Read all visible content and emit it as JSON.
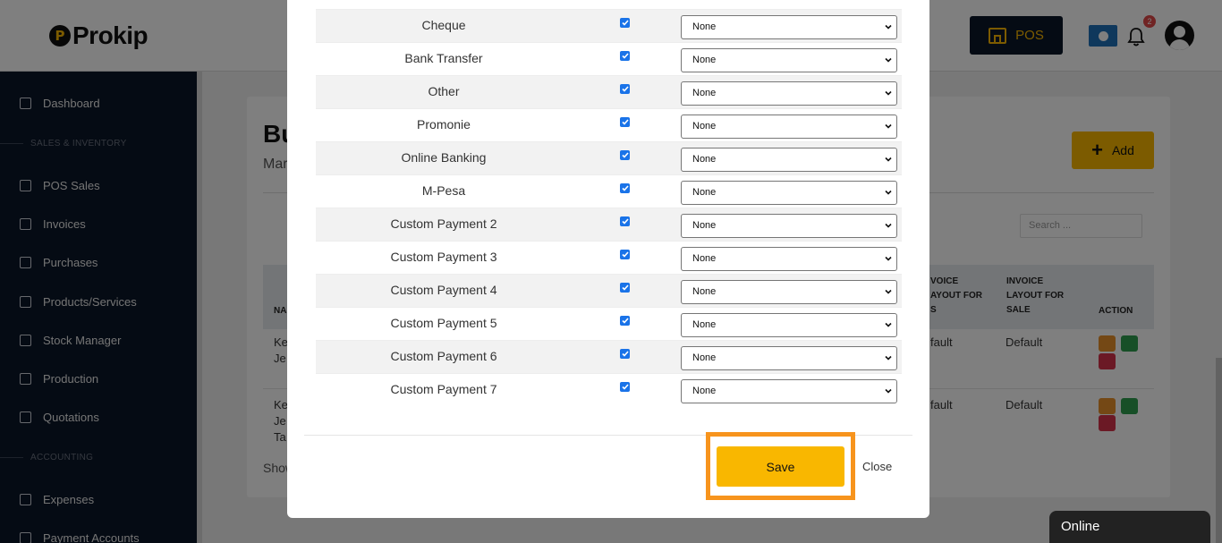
{
  "app": {
    "logo_text": "Prokip",
    "logo_mark": "P",
    "pos_label": "POS",
    "notification_count": "2"
  },
  "sidebar": {
    "items": [
      {
        "label": "Dashboard",
        "icon": "home-icon"
      },
      {
        "label": "POS Sales",
        "icon": "bag-icon"
      },
      {
        "label": "Invoices",
        "icon": "invoice-icon"
      },
      {
        "label": "Purchases",
        "icon": "cart-icon"
      },
      {
        "label": "Products/Services",
        "icon": "box-icon"
      },
      {
        "label": "Stock Manager",
        "icon": "stock-icon"
      },
      {
        "label": "Production",
        "icon": "building-icon"
      },
      {
        "label": "Quotations",
        "icon": "quote-icon"
      },
      {
        "label": "Expenses",
        "icon": "clock-icon"
      },
      {
        "label": "Payment Accounts",
        "icon": "wallet-icon"
      }
    ],
    "headings": [
      "SALES & INVENTORY",
      "ACCOUNTING"
    ]
  },
  "background_page": {
    "title_partial": "Bu",
    "subtitle_partial": "Mar",
    "add_label": "Add",
    "search_placeholder": "Search ...",
    "table": {
      "headers": [
        "NA",
        "VOICE LAYOUT FOR S",
        "INVOICE LAYOUT FOR SALE",
        "ACTION"
      ],
      "header_col_a_partial": "NA",
      "header_invoice_pos": "VOICE\nAYOUT FOR\nS",
      "header_invoice_sale": "INVOICE\nLAYOUT FOR\nSALE",
      "header_action": "ACTION",
      "rows": [
        {
          "name_partial": "Ke\nJe",
          "layout_pos_partial": "fault",
          "layout_sale": "Default"
        },
        {
          "name_partial": "Ke\nJe\nTa",
          "layout_pos_partial": "fault",
          "layout_sale": "Default"
        }
      ]
    },
    "show_partial": "Show"
  },
  "modal": {
    "rows": [
      {
        "name": "Cheque",
        "checked": true,
        "account": "None"
      },
      {
        "name": "Bank Transfer",
        "checked": true,
        "account": "None"
      },
      {
        "name": "Other",
        "checked": true,
        "account": "None"
      },
      {
        "name": "Promonie",
        "checked": true,
        "account": "None"
      },
      {
        "name": "Online Banking",
        "checked": true,
        "account": "None"
      },
      {
        "name": "M-Pesa",
        "checked": true,
        "account": "None"
      },
      {
        "name": "Custom Payment 2",
        "checked": true,
        "account": "None"
      },
      {
        "name": "Custom Payment 3",
        "checked": true,
        "account": "None"
      },
      {
        "name": "Custom Payment 4",
        "checked": true,
        "account": "None"
      },
      {
        "name": "Custom Payment 5",
        "checked": true,
        "account": "None"
      },
      {
        "name": "Custom Payment 6",
        "checked": true,
        "account": "None"
      },
      {
        "name": "Custom Payment 7",
        "checked": true,
        "account": "None"
      }
    ],
    "save_label": "Save",
    "close_label": "Close"
  },
  "chat": {
    "status_label": "Online"
  },
  "colors": {
    "brand_yellow": "#f9b700",
    "sidebar_navy": "#0b1628",
    "highlight_orange": "#f7941d",
    "checkbox_blue": "#1a73e8"
  }
}
